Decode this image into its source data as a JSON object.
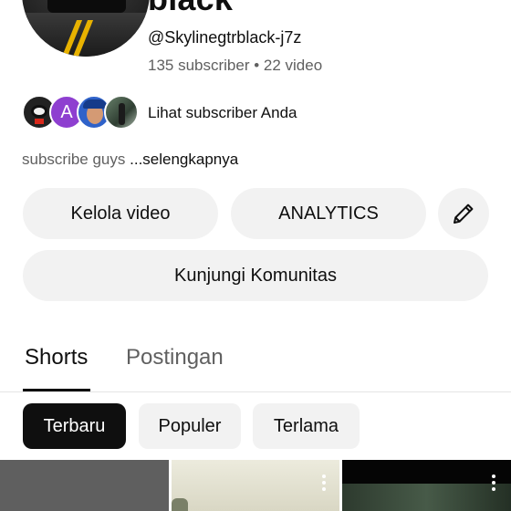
{
  "channel": {
    "name": "black",
    "handle": "@Skylinegtrblack-j7z",
    "stats": "135 subscriber • 22 video",
    "subscribers_label": "Lihat subscriber Anda",
    "subscriber_avatar_letter": "A",
    "description": "subscribe guys",
    "description_more": "...selengkapnya"
  },
  "actions": {
    "manage_videos": "Kelola video",
    "analytics": "ANALYTICS",
    "edit_icon": "pencil-icon",
    "visit_community": "Kunjungi Komunitas"
  },
  "tabs": [
    {
      "label": "Shorts",
      "selected": true
    },
    {
      "label": "Postingan",
      "selected": false
    }
  ],
  "filters": [
    {
      "label": "Terbaru",
      "selected": true
    },
    {
      "label": "Populer",
      "selected": false
    },
    {
      "label": "Terlama",
      "selected": false
    }
  ],
  "colors": {
    "text_primary": "#0f0f0f",
    "text_secondary": "#606060",
    "button_bg": "#f2f2f2",
    "chip_selected_bg": "#0f0f0f"
  }
}
